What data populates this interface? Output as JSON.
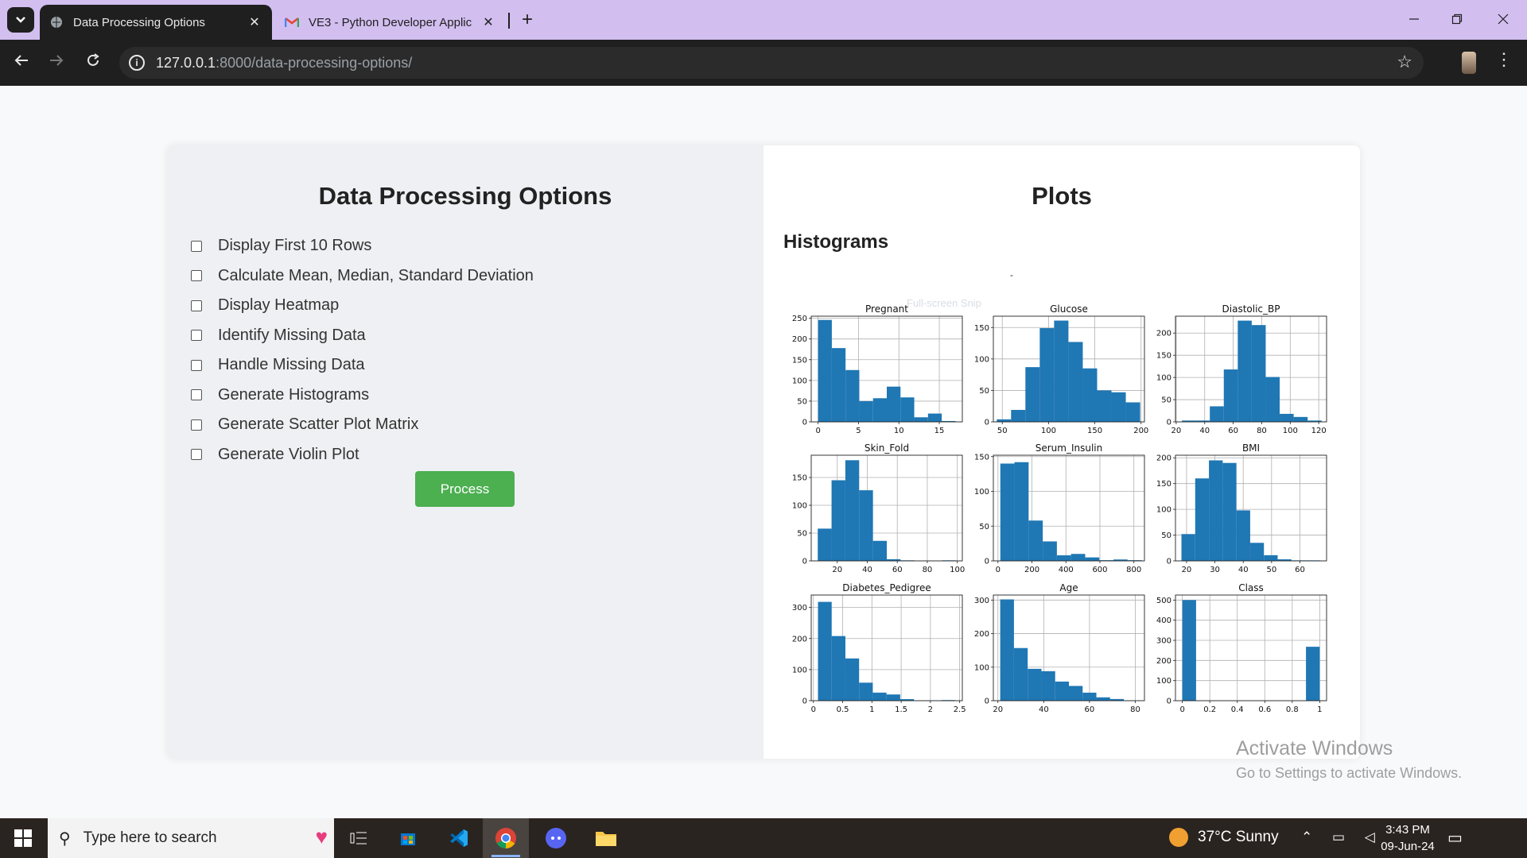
{
  "browser": {
    "tabs": [
      {
        "title": "Data Processing Options",
        "close": "✕",
        "active": true
      },
      {
        "title": "VE3 - Python Developer Applic",
        "close": "✕",
        "active": false
      }
    ],
    "new_tab": "+",
    "url_host": "127.0.0.1",
    "url_path": ":8000/data-processing-options/"
  },
  "left": {
    "title": "Data Processing Options",
    "options": [
      "Display First 10 Rows",
      "Calculate Mean, Median, Standard Deviation",
      "Display Heatmap",
      "Identify Missing Data",
      "Handle Missing Data",
      "Generate Histograms",
      "Generate Scatter Plot Matrix",
      "Generate Violin Plot"
    ],
    "button": "Process"
  },
  "right": {
    "title": "Plots",
    "subtitle": "Histograms",
    "faint_overlay": "Full-screen Snip",
    "dash": "-"
  },
  "chart_data": [
    {
      "type": "bar",
      "title": "Pregnant",
      "xlim": [
        -0.85,
        17.85
      ],
      "ylim": [
        0,
        255
      ],
      "xticks": [
        0,
        5,
        10,
        15
      ],
      "yticks": [
        0,
        50,
        100,
        150,
        200,
        250
      ],
      "bins": [
        0,
        1.7,
        3.4,
        5.1,
        6.8,
        8.5,
        10.2,
        11.9,
        13.6,
        15.3,
        17
      ],
      "values": [
        246,
        178,
        125,
        50,
        57,
        85,
        59,
        11,
        20,
        2
      ],
      "color": "#1f77b4"
    },
    {
      "type": "bar",
      "title": "Glucose",
      "xlim": [
        40.35,
        203.65
      ],
      "ylim": [
        0,
        168
      ],
      "xticks": [
        50,
        100,
        150,
        200
      ],
      "yticks": [
        0,
        50,
        100,
        150
      ],
      "bins": [
        44,
        59.5,
        75,
        90.5,
        106,
        121.5,
        137,
        152.5,
        168,
        183.5,
        199
      ],
      "values": [
        4,
        19,
        87,
        149,
        161,
        127,
        85,
        50,
        47,
        31
      ],
      "color": "#1f77b4"
    },
    {
      "type": "bar",
      "title": "Diastolic_BP",
      "xlim": [
        19.5,
        125.5
      ],
      "ylim": [
        0,
        238
      ],
      "xticks": [
        20,
        40,
        60,
        80,
        100,
        120
      ],
      "yticks": [
        0,
        50,
        100,
        150,
        200
      ],
      "bins": [
        24,
        33.8,
        43.6,
        53.4,
        63.2,
        73,
        82.8,
        92.6,
        102.4,
        112.2,
        122
      ],
      "values": [
        3,
        3,
        35,
        118,
        228,
        218,
        101,
        18,
        11,
        3
      ],
      "color": "#1f77b4"
    },
    {
      "type": "bar",
      "title": "Skin_Fold",
      "xlim": [
        2.65,
        103.35
      ],
      "ylim": [
        0,
        190
      ],
      "xticks": [
        20,
        40,
        60,
        80,
        100
      ],
      "yticks": [
        0,
        50,
        100,
        150
      ],
      "bins": [
        7,
        16.2,
        25.4,
        34.6,
        43.8,
        53,
        62.2,
        71.4,
        80.6,
        89.8,
        99
      ],
      "values": [
        58,
        145,
        181,
        127,
        36,
        3,
        1,
        0,
        0,
        1
      ],
      "color": "#1f77b4"
    },
    {
      "type": "bar",
      "title": "Serum_Insulin",
      "xlim": [
        -27.15,
        862.15
      ],
      "ylim": [
        0,
        152
      ],
      "xticks": [
        0,
        200,
        400,
        600,
        800
      ],
      "yticks": [
        0,
        50,
        100,
        150
      ],
      "bins": [
        14,
        97.2,
        180.4,
        263.6,
        346.8,
        430,
        513.2,
        596.4,
        679.6,
        762.8,
        846
      ],
      "values": [
        140,
        142,
        58,
        28,
        8,
        10,
        5,
        1,
        2,
        1
      ],
      "color": "#1f77b4"
    },
    {
      "type": "bar",
      "title": "BMI",
      "xlim": [
        16.09,
        69.41
      ],
      "ylim": [
        0,
        205
      ],
      "xticks": [
        20,
        30,
        40,
        50,
        60
      ],
      "yticks": [
        0,
        50,
        100,
        150,
        200
      ],
      "bins": [
        18.2,
        23.05,
        27.9,
        32.75,
        37.6,
        42.45,
        47.3,
        52.15,
        57,
        61.85,
        67.1
      ],
      "values": [
        52,
        160,
        195,
        190,
        98,
        35,
        11,
        3,
        1,
        1
      ],
      "color": "#1f77b4"
    },
    {
      "type": "bar",
      "title": "Diabetes_Pedigree",
      "xlim": [
        -0.0375,
        2.5455
      ],
      "ylim": [
        0,
        340
      ],
      "xticks": [
        0.0,
        0.5,
        1.0,
        1.5,
        2.0,
        2.5
      ],
      "yticks": [
        0,
        100,
        200,
        300
      ],
      "bins": [
        0.078,
        0.3123,
        0.5466,
        0.7809,
        1.0152,
        1.2495,
        1.4838,
        1.7181,
        1.9524,
        2.1867,
        2.42
      ],
      "values": [
        318,
        208,
        136,
        58,
        26,
        20,
        5,
        1,
        1,
        2
      ],
      "color": "#1f77b4"
    },
    {
      "type": "bar",
      "title": "Age",
      "xlim": [
        18,
        84
      ],
      "ylim": [
        0,
        315
      ],
      "xticks": [
        20,
        40,
        60,
        80
      ],
      "yticks": [
        0,
        100,
        200,
        300
      ],
      "bins": [
        21,
        27,
        33,
        39,
        45,
        51,
        57,
        63,
        69,
        75,
        81
      ],
      "values": [
        302,
        157,
        95,
        88,
        57,
        44,
        24,
        10,
        5,
        1
      ],
      "color": "#1f77b4"
    },
    {
      "type": "bar",
      "title": "Class",
      "xlim": [
        -0.05,
        1.05
      ],
      "ylim": [
        0,
        525
      ],
      "xticks": [
        0.0,
        0.2,
        0.4,
        0.6,
        0.8,
        1.0
      ],
      "yticks": [
        0,
        100,
        200,
        300,
        400,
        500
      ],
      "bins": [
        0,
        0.1,
        0.2,
        0.3,
        0.4,
        0.5,
        0.6,
        0.7,
        0.8,
        0.9,
        1.0
      ],
      "values": [
        500,
        0,
        0,
        0,
        0,
        0,
        0,
        0,
        0,
        268
      ],
      "color": "#1f77b4"
    }
  ],
  "watermark": {
    "line1": "Activate Windows",
    "line2": "Go to Settings to activate Windows."
  },
  "taskbar": {
    "search_placeholder": "Type here to search",
    "weather": "37°C  Sunny",
    "time": "3:43 PM",
    "date": "09-Jun-24"
  }
}
